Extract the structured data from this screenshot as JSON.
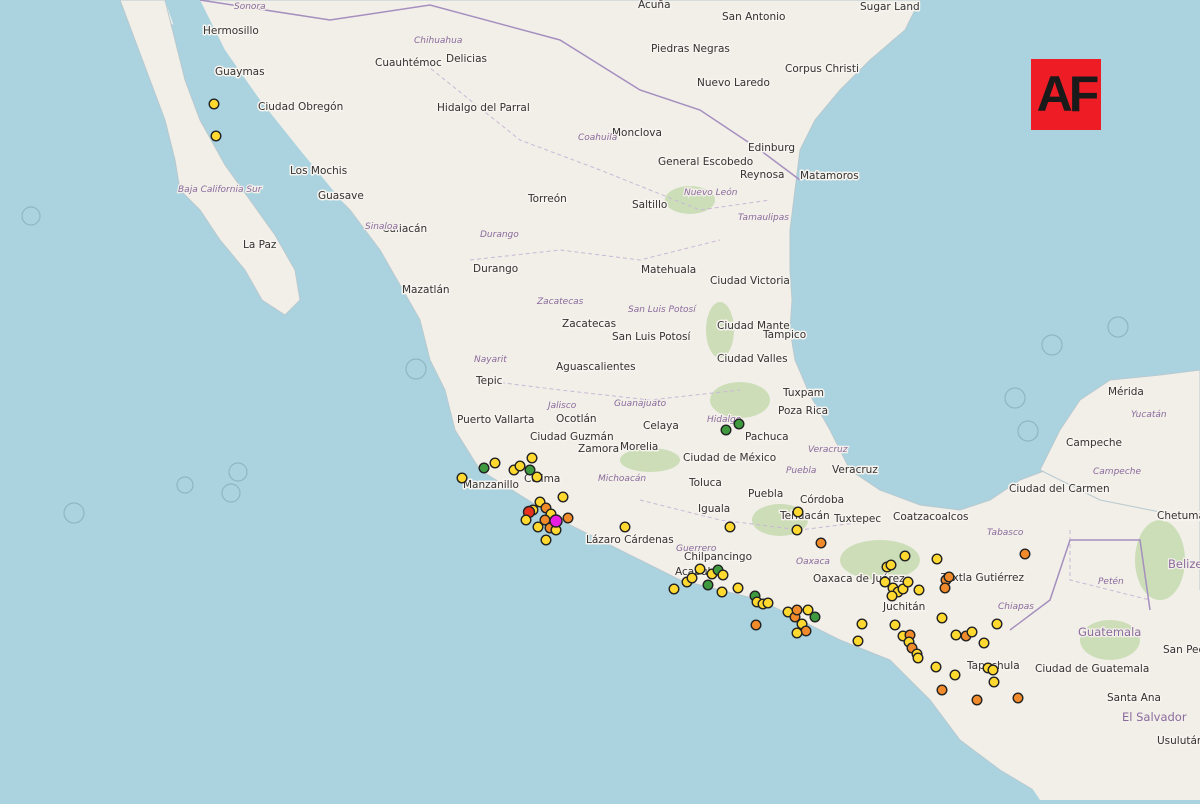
{
  "logo": {
    "text": "AF"
  },
  "colors": {
    "water": "#aad3df",
    "land": "#f2efe9",
    "forest": "#c8dcb2",
    "quake_yellow": "#ffd92f",
    "quake_orange": "#f08a2a",
    "quake_green": "#3f9a3f",
    "quake_red": "#e8321e",
    "quake_magenta": "#e81ee0"
  },
  "labels": {
    "cities": [
      "Hermosillo",
      "Sonora",
      "Guaymas",
      "Ciudad Obregón",
      "Los Mochis",
      "Guasave",
      "La Paz",
      "Culiacán",
      "Mazatlán",
      "Tepic",
      "Puerto Vallarta",
      "Manzanillo",
      "Colima",
      "Ciudad Guzmán",
      "Zamora",
      "Ocotlán",
      "Aguascalientes",
      "Zacatecas",
      "San Luis Potosí",
      "Durango",
      "Torreón",
      "Chihuahua",
      "Cuauhtémoc",
      "Delicias",
      "Hidalgo del Parral",
      "Monclova",
      "Saltillo",
      "General Escobedo",
      "Reynosa",
      "Matamoros",
      "Edinburg",
      "Nuevo Laredo",
      "Piedras Negras",
      "Acuña",
      "San Antonio",
      "Corpus Christi",
      "Sugar Land",
      "Matehuala",
      "Ciudad Victoria",
      "Ciudad Mante",
      "Ciudad Valles",
      "Tampico",
      "Tuxpam",
      "Poza Rica",
      "Pachuca",
      "Celaya",
      "Morelia",
      "Ciudad de México",
      "Toluca",
      "Puebla",
      "Iguala",
      "Tehuacán",
      "Córdoba",
      "Veracruz",
      "Tuxtepec",
      "Coatzacoalcos",
      "Oaxaca de Juárez",
      "Juchitán",
      "Tuxtla Gutiérrez",
      "Tapachula",
      "Ciudad de Guatemala",
      "Guatemala",
      "Santa Ana",
      "El Salvador",
      "Usulután",
      "San Pedro Sula",
      "Belize City",
      "Mérida",
      "Campeche",
      "Ciudad del Carmen",
      "Chetumal",
      "Acapulco",
      "Lázaro Cárdenas",
      "Chilpancingo"
    ],
    "states": [
      "Baja California Sur",
      "Sinaloa",
      "Durango",
      "Coahuila",
      "Nuevo León",
      "Tamaulipas",
      "Zacatecas",
      "San Luis Potosí",
      "Nayarit",
      "Jalisco",
      "Guanajuato",
      "Michoacán",
      "Hidalgo",
      "Puebla",
      "Veracruz",
      "Guerrero",
      "Oaxaca",
      "Tabasco",
      "Chiapas",
      "Campeche",
      "Yucatán",
      "Petén",
      "Belize"
    ]
  }
}
